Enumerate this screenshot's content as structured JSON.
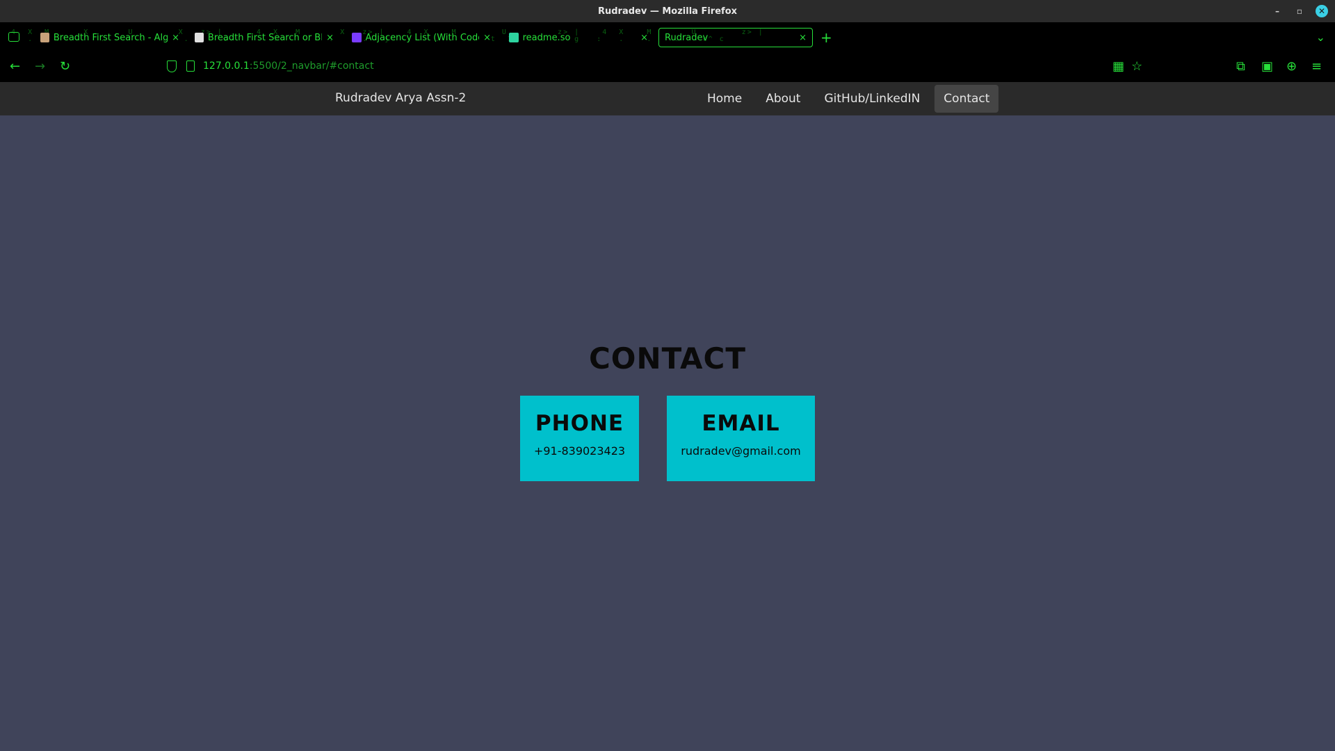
{
  "window": {
    "title": "Rudradev — Mozilla Firefox",
    "controls": {
      "minimize": "–",
      "restore": "▫",
      "close": "✕"
    }
  },
  "tabs": [
    {
      "label": "Breadth First Search - Algor",
      "favicon_color": "#c8a27a",
      "active": false
    },
    {
      "label": "Breadth First Search or BFS",
      "favicon_color": "#e0e0e0",
      "active": false
    },
    {
      "label": "Adjacency List (With Code",
      "favicon_color": "#7a3cff",
      "active": false
    },
    {
      "label": "readme.so",
      "favicon_color": "#2ed4a0",
      "active": false
    },
    {
      "label": "Rudradev",
      "favicon_color": "",
      "active": true
    }
  ],
  "tab_close": "×",
  "new_tab": "+",
  "overflow": "⌄",
  "toolbar": {
    "back": "←",
    "forward": "→",
    "reload": "↻",
    "url_host": "127.0.0.1",
    "url_path": ":5500/2_navbar/#contact",
    "qr": "▦",
    "bookmark": "☆",
    "extensions": "⧉",
    "apps": "▣",
    "account": "⊕",
    "menu": "≡"
  },
  "site": {
    "brand": "Rudradev Arya Assn-2",
    "nav": [
      {
        "label": "Home",
        "active": false
      },
      {
        "label": "About",
        "active": false
      },
      {
        "label": "GitHub/LinkedIN",
        "active": false
      },
      {
        "label": "Contact",
        "active": true
      }
    ],
    "section_title": "CONTACT",
    "phone": {
      "heading": "PHONE",
      "value": "+91-839023423"
    },
    "email": {
      "heading": "EMAIL",
      "value": "rudradev@gmail.com"
    }
  },
  "colors": {
    "accent_green": "#27e03a",
    "card": "#00c0cc",
    "page_bg": "#40445a",
    "navbar_bg": "#2a2a2a"
  }
}
